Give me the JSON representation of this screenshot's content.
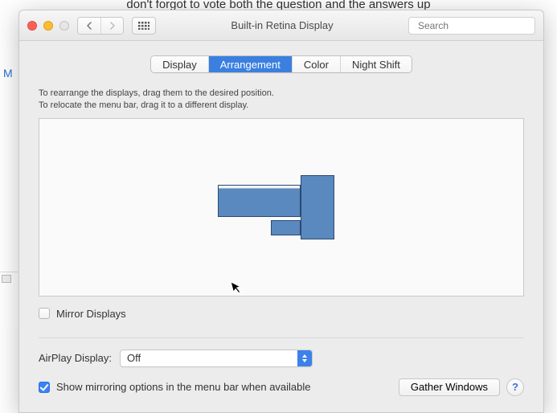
{
  "behind_text": "don't forgot to vote both the question and the answers up",
  "titlebar": {
    "title": "Built-in Retina Display",
    "search_placeholder": "Search"
  },
  "tabs": [
    "Display",
    "Arrangement",
    "Color",
    "Night Shift"
  ],
  "active_tab_index": 1,
  "instructions_line1": "To rearrange the displays, drag them to the desired position.",
  "instructions_line2": "To relocate the menu bar, drag it to a different display.",
  "mirror_label": "Mirror Displays",
  "mirror_checked": false,
  "airplay": {
    "label": "AirPlay Display:",
    "value": "Off"
  },
  "show_mirroring_label": "Show mirroring options in the menu bar when available",
  "show_mirroring_checked": true,
  "gather_button": "Gather Windows",
  "help_char": "?",
  "sidebar_letter": "M"
}
